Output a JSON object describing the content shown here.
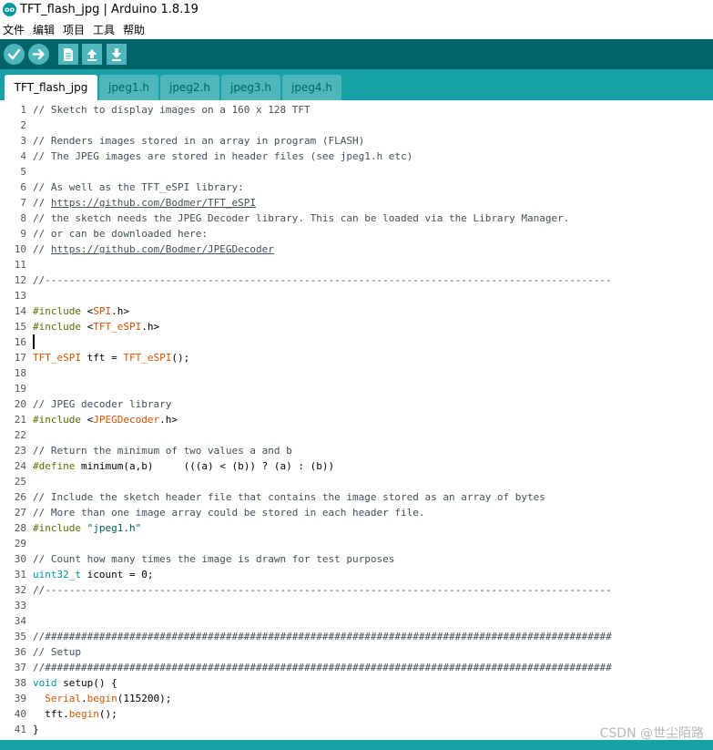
{
  "window": {
    "title": "TFT_flash_jpg | Arduino 1.8.19",
    "logo_text": "oo"
  },
  "menu": [
    "文件",
    "编辑",
    "项目",
    "工具",
    "帮助"
  ],
  "toolbar": [
    "verify-icon",
    "upload-icon",
    "new-icon",
    "open-icon",
    "save-icon"
  ],
  "tabs": [
    "TFT_flash_jpg",
    "jpeg1.h",
    "jpeg2.h",
    "jpeg3.h",
    "jpeg4.h"
  ],
  "active_tab": 0,
  "colors": {
    "toolbar_bg": "#006468",
    "tabbar_bg": "#17a1a5",
    "button_bg": "#4db7bb",
    "comment": "#434f54",
    "preprocessor": "#5e6d03",
    "keyword": "#d35400",
    "type": "#00979c"
  },
  "caret_line": 16,
  "code": [
    [
      [
        "// Sketch to display images on a 160 x 128 TFT",
        "cmt"
      ]
    ],
    [],
    [
      [
        "// Renders images stored in an array in program (FLASH)",
        "cmt"
      ]
    ],
    [
      [
        "// The JPEG images are stored in header files (see jpeg1.h etc)",
        "cmt"
      ]
    ],
    [],
    [
      [
        "// As well as the TFT_eSPI library:",
        "cmt"
      ]
    ],
    [
      [
        "// ",
        "cmt"
      ],
      [
        "https://github.com/Bodmer/TFT_eSPI",
        "cmt url"
      ]
    ],
    [
      [
        "// the sketch needs the JPEG Decoder library. This can be loaded via the Library Manager.",
        "cmt"
      ]
    ],
    [
      [
        "// or can be downloaded here:",
        "cmt"
      ]
    ],
    [
      [
        "// ",
        "cmt"
      ],
      [
        "https://github.com/Bodmer/JPEGDecoder",
        "cmt url"
      ]
    ],
    [],
    [
      [
        "//----------------------------------------------------------------------------------------------",
        "cmt"
      ]
    ],
    [],
    [
      [
        "#include",
        "pre"
      ],
      [
        " <",
        ""
      ],
      [
        "SPI",
        "kw"
      ],
      [
        ".h>",
        ""
      ]
    ],
    [
      [
        "#include",
        "pre"
      ],
      [
        " <",
        ""
      ],
      [
        "TFT_eSPI",
        "kw"
      ],
      [
        ".h>",
        ""
      ]
    ],
    [],
    [
      [
        "TFT_eSPI",
        "kw"
      ],
      [
        " tft = ",
        ""
      ],
      [
        "TFT_eSPI",
        "kw"
      ],
      [
        "();",
        ""
      ]
    ],
    [],
    [],
    [
      [
        "// JPEG decoder library",
        "cmt"
      ]
    ],
    [
      [
        "#include",
        "pre"
      ],
      [
        " <",
        ""
      ],
      [
        "JPEGDecoder",
        "kw"
      ],
      [
        ".h>",
        ""
      ]
    ],
    [],
    [
      [
        "// Return the minimum of two values a and b",
        "cmt"
      ]
    ],
    [
      [
        "#define",
        "pre"
      ],
      [
        " minimum(a,b)     (((a) < (b)) ? (a) : (b))",
        ""
      ]
    ],
    [],
    [
      [
        "// Include the sketch header file that contains the image stored as an array of bytes",
        "cmt"
      ]
    ],
    [
      [
        "// More than one image array could be stored in each header file.",
        "cmt"
      ]
    ],
    [
      [
        "#include",
        "pre"
      ],
      [
        " \"jpeg1.h\"",
        "str"
      ]
    ],
    [],
    [
      [
        "// Count how many times the image is drawn for test purposes",
        "cmt"
      ]
    ],
    [
      [
        "uint32_t",
        "typ"
      ],
      [
        " icount = 0;",
        ""
      ]
    ],
    [
      [
        "//----------------------------------------------------------------------------------------------",
        "cmt"
      ]
    ],
    [],
    [],
    [
      [
        "//##############################################################################################",
        "cmt"
      ]
    ],
    [
      [
        "// Setup",
        "cmt"
      ]
    ],
    [
      [
        "//##############################################################################################",
        "cmt"
      ]
    ],
    [
      [
        "void",
        "typ"
      ],
      [
        " setup() {",
        ""
      ]
    ],
    [
      [
        "  ",
        ""
      ],
      [
        "Serial",
        "kw"
      ],
      [
        ".",
        ""
      ],
      [
        "begin",
        "kw"
      ],
      [
        "(115200);",
        ""
      ]
    ],
    [
      [
        "  tft.",
        ""
      ],
      [
        "begin",
        "kw"
      ],
      [
        "();",
        ""
      ]
    ],
    [
      [
        "}",
        ""
      ]
    ]
  ],
  "watermark": "CSDN @世尘陌路"
}
